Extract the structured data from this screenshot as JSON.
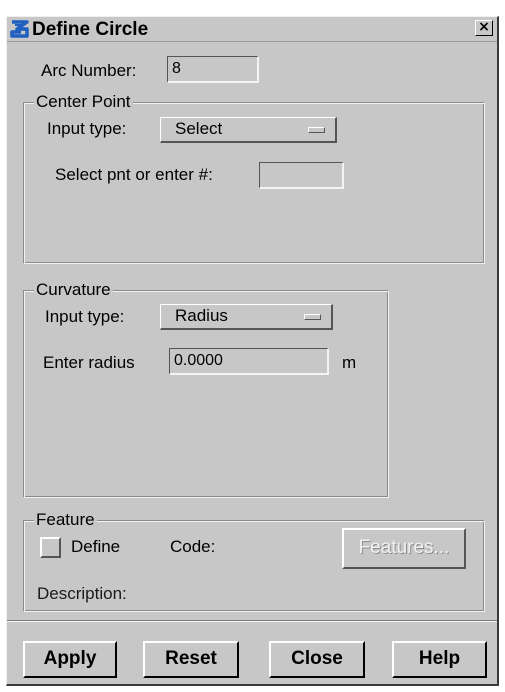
{
  "window": {
    "title": "Define Circle",
    "close_glyph": "×",
    "app_icon": "app-logo-icon",
    "accent_color": "#1f5fbf"
  },
  "arc": {
    "label": "Arc Number:",
    "value": "8"
  },
  "center_point": {
    "title": "Center Point",
    "input_type_label": "Input type:",
    "input_type_value": "Select",
    "select_label": "Select pnt or enter #:",
    "select_value": ""
  },
  "curvature": {
    "title": "Curvature",
    "input_type_label": "Input type:",
    "input_type_value": "Radius",
    "radius_label": "Enter radius",
    "radius_value": "0.0000",
    "radius_unit": "m"
  },
  "feature": {
    "title": "Feature",
    "define_label": "Define",
    "define_checked": false,
    "code_label": "Code:",
    "features_button": "Features...",
    "description_label": "Description:"
  },
  "buttons": {
    "apply": "Apply",
    "reset": "Reset",
    "close": "Close",
    "help": "Help"
  }
}
